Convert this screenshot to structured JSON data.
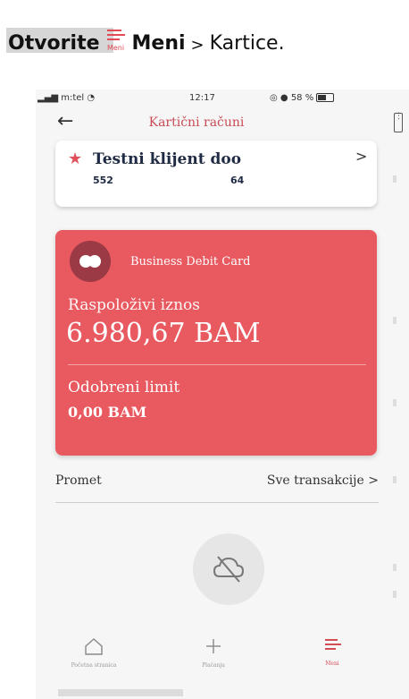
{
  "instruction": {
    "open": "Otvorite",
    "menu_caption": "Meni",
    "menu_label": "Meni",
    "separator": ">",
    "target": "Kartice."
  },
  "status_bar": {
    "carrier": "m:tel",
    "time": "12:17",
    "battery": "58 %"
  },
  "nav": {
    "back_icon": "arrow-left-icon",
    "title": "Kartični računi"
  },
  "client": {
    "name": "Testni klijent doo",
    "number_left": "552",
    "number_right": "64"
  },
  "card": {
    "name": "Business Debit Card",
    "available_label": "Raspoloživi iznos",
    "available_amount": "6.980,67 BAM",
    "limit_label": "Odobreni limit",
    "limit_amount": "0,00 BAM",
    "color": "#e85960"
  },
  "transactions": {
    "label": "Promet",
    "link": "Sve transakcije"
  },
  "tabbar": {
    "items": [
      {
        "label": "Početna stranica",
        "icon": "home-icon"
      },
      {
        "label": "Plaćanja",
        "icon": "plus-icon"
      },
      {
        "label": "Meni",
        "icon": "menu-icon"
      }
    ],
    "accent": "#d44c55"
  }
}
